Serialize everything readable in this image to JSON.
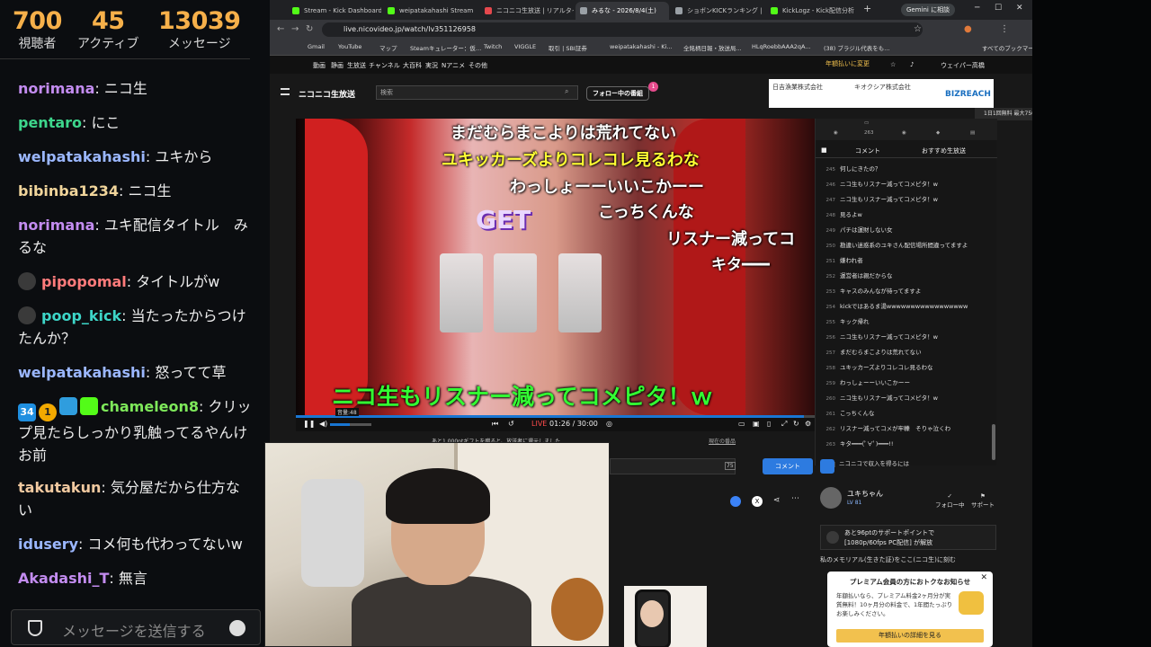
{
  "overlay": {
    "stats": [
      {
        "value": "700",
        "label": "視聴者"
      },
      {
        "value": "45",
        "label": "アクティブ"
      },
      {
        "value": "13039",
        "label": "メッセージ"
      }
    ],
    "chat": [
      {
        "user": "norimana",
        "color": "#c38cf0",
        "text": ": ニコ生"
      },
      {
        "user": "pentaro",
        "color": "#3dd68c",
        "text": ": にこ"
      },
      {
        "user": "welpatakahashi",
        "color": "#9bb7ff",
        "text": ": ユキから"
      },
      {
        "user": "bibinba1234",
        "color": "#f1d59b",
        "text": ": ニコ生"
      },
      {
        "user": "norimana",
        "color": "#c38cf0",
        "text": ": ユキ配信タイトル　みるな"
      },
      {
        "user": "pipopomal",
        "color": "#ff7b7b",
        "text": ": タイトルがw"
      },
      {
        "user": "poop_kick",
        "color": "#3dd6c8",
        "text": ": 当たったからつけたんか？"
      },
      {
        "user": "welpatakahashi",
        "color": "#9bb7ff",
        "text": ": 怒ってて草"
      },
      {
        "user": "chameleon8",
        "color": "#7ee85a",
        "text": ": クリップ見たらしっかり乳触ってるやんけお前"
      },
      {
        "user": "takutakun",
        "color": "#f1c9a0",
        "text": ": 気分屋だから仕方ない"
      },
      {
        "user": "idusery",
        "color": "#9bb7ff",
        "text": ": コメ何も代わってないw"
      },
      {
        "user": "Akadashi_T",
        "color": "#c38cf0",
        "text": ": 無言"
      }
    ],
    "badges": {
      "sub": "34",
      "gift": "1"
    },
    "input_placeholder": "メッセージを送信する"
  },
  "browser": {
    "tabs": [
      {
        "label": "Stream - Kick Dashboard",
        "color": "#53fc18"
      },
      {
        "label": "weipatakahashi Stream",
        "color": "#53fc18"
      },
      {
        "label": "ニコニコ生放送 | リアルタイム",
        "color": "#e5484d"
      },
      {
        "label": "みるな - 2026/8/4(土)",
        "color": "#9aa0a6"
      },
      {
        "label": "ショボンKICKランキング | Sk",
        "color": "#9aa0a6"
      },
      {
        "label": "KickLogz - Kick配信分析",
        "color": "#53fc18"
      }
    ],
    "gemini": "Gemini に相談",
    "url": "live.nicovideo.jp/watch/lv351126958",
    "bookmarks": [
      "Gmail",
      "YouTube",
      "マップ",
      "Steamキュレーター：仮…",
      "Twitch",
      "VIGGLE",
      "取引 | SBI証券",
      "weipatakahashi - Ki...",
      "全銘柄日報・放送局...",
      "HLqRoebbAAA2qA...",
      "(38) ブラジル代表をも..."
    ],
    "bookmarks_all": "すべてのブックマーク"
  },
  "site": {
    "topnav": [
      "動画",
      "静画",
      "生放送",
      "チャンネル",
      "大百科",
      "実況",
      "Nアニメ",
      "その他"
    ],
    "premium_link": "年額払いに変更",
    "user": "ウェイパー高橋",
    "logo": "ニコニコ生放送",
    "search_placeholder": "検索",
    "follow_button": "フォロー中の番組",
    "follow_count": "1",
    "ad": {
      "left": "日吉漁業株式会社",
      "mid": "キオクシア株式会社",
      "brand": "BIZREACH"
    },
    "promo": "1日1回無料 最大7500pt"
  },
  "player": {
    "nico_comments": [
      {
        "text": "まだむらまこよりは荒れてない",
        "color": "#ffffff"
      },
      {
        "text": "ユキッカーズよりコレコレ見るわな",
        "color": "#ffff33"
      },
      {
        "text": "わっしょーーいいこかーー",
        "color": "#ffffff"
      },
      {
        "text": "こっちくんな",
        "color": "#ffffff"
      },
      {
        "text": "リスナー減ってコ",
        "color": "#ffffff"
      },
      {
        "text": "キタ━━━",
        "color": "#ffffff"
      },
      {
        "text": "ニコ生もリスナー減ってコメピタ！ｗ",
        "color": "#33ff33"
      }
    ],
    "volume_tip": "音量:48",
    "volume_fraction": 0.48,
    "progress_fraction": 0.98,
    "live_label": "LIVE",
    "time": "01:26 / 30:00"
  },
  "comment_panel": {
    "viewers": "263",
    "tabs": [
      "コメント",
      "おすすめ生放送"
    ],
    "comments": [
      {
        "no": "245",
        "text": "何しにきたの？"
      },
      {
        "no": "246",
        "text": "ニコ生もリスナー減ってコメピタ！w"
      },
      {
        "no": "247",
        "text": "ニコ生もリスナー減ってコメピタ！w"
      },
      {
        "no": "248",
        "text": "見るよw"
      },
      {
        "no": "249",
        "text": "パチは運財しない女"
      },
      {
        "no": "250",
        "text": "勘違い迷惑系のユキさん配信場所間違ってますよ"
      },
      {
        "no": "251",
        "text": "嫌われ者"
      },
      {
        "no": "252",
        "text": "運営者は親だからな"
      },
      {
        "no": "253",
        "text": "キャスのみんなが待ってますよ"
      },
      {
        "no": "254",
        "text": "kickではあるま湯wwwwwwwwwwwwwwwww"
      },
      {
        "no": "255",
        "text": "キック帰れ"
      },
      {
        "no": "256",
        "text": "ニコ生もリスナー減ってコメピタ！w"
      },
      {
        "no": "257",
        "text": "まだむらまこよりは荒れてない"
      },
      {
        "no": "258",
        "text": "ユキッカーズよりコレコレ見るわな"
      },
      {
        "no": "259",
        "text": "わっしょーーいいこかーー"
      },
      {
        "no": "260",
        "text": "ニコ生もリスナー減ってコメピタ！w"
      },
      {
        "no": "261",
        "text": "こっちくんな"
      },
      {
        "no": "262",
        "text": "リスナー減ってコメが牢轢　そりゃ泣くわ"
      },
      {
        "no": "263",
        "text": "キタ━━━(ﾟ∀ﾟ)━━━!!"
      }
    ],
    "info": "ニコニコで収入を得るには"
  },
  "below": {
    "comment_button": "コメント",
    "info_line": "あと1,000ptギフトを贈ると、放送者に還元しました",
    "button_line": "現在の番品",
    "caster_name": "ユキちゃん",
    "caster_level": "LV 81",
    "actions": [
      "フォロー中",
      "サポート"
    ],
    "support_line1": "あと96ptのサポートポイントで",
    "support_line2": "[1080p/60fps PC配信] が解放",
    "memorial": "私のメモリアル(生きた証)をここ(ニコ生)に刻む",
    "popup": {
      "title": "プレミアム会員の方におトクなお知らせ",
      "body": "年額払いなら、プレミアム料金2ヶ月分が実質無料！10ヶ月分の料金で、1年間たっぷりお楽しみください。",
      "button": "年額払いの詳細を見る"
    }
  }
}
